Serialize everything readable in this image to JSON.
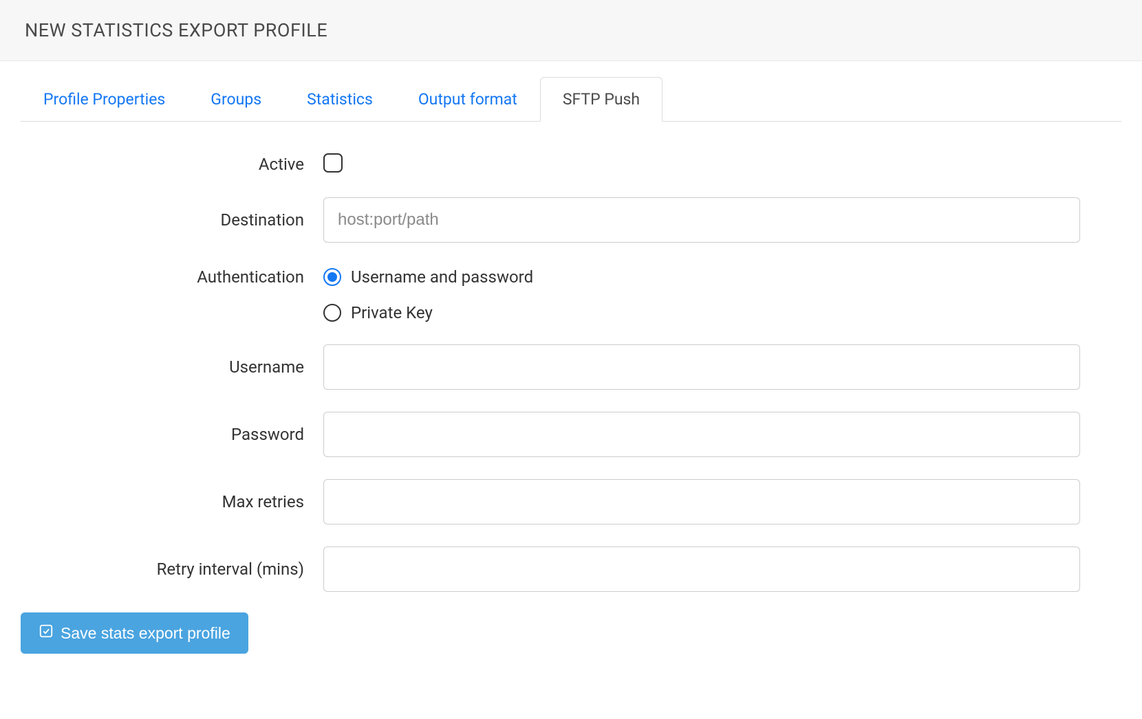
{
  "header": {
    "title": "NEW STATISTICS EXPORT PROFILE"
  },
  "tabs": [
    {
      "label": "Profile Properties",
      "active": false
    },
    {
      "label": "Groups",
      "active": false
    },
    {
      "label": "Statistics",
      "active": false
    },
    {
      "label": "Output format",
      "active": false
    },
    {
      "label": "SFTP Push",
      "active": true
    }
  ],
  "form": {
    "active": {
      "label": "Active",
      "checked": false
    },
    "destination": {
      "label": "Destination",
      "placeholder": "host:port/path",
      "value": ""
    },
    "authentication": {
      "label": "Authentication",
      "options": [
        {
          "label": "Username and password",
          "selected": true
        },
        {
          "label": "Private Key",
          "selected": false
        }
      ]
    },
    "username": {
      "label": "Username",
      "value": ""
    },
    "password": {
      "label": "Password",
      "value": ""
    },
    "max_retries": {
      "label": "Max retries",
      "value": ""
    },
    "retry_interval": {
      "label": "Retry interval (mins)",
      "value": ""
    }
  },
  "actions": {
    "save_label": "Save stats export profile"
  }
}
